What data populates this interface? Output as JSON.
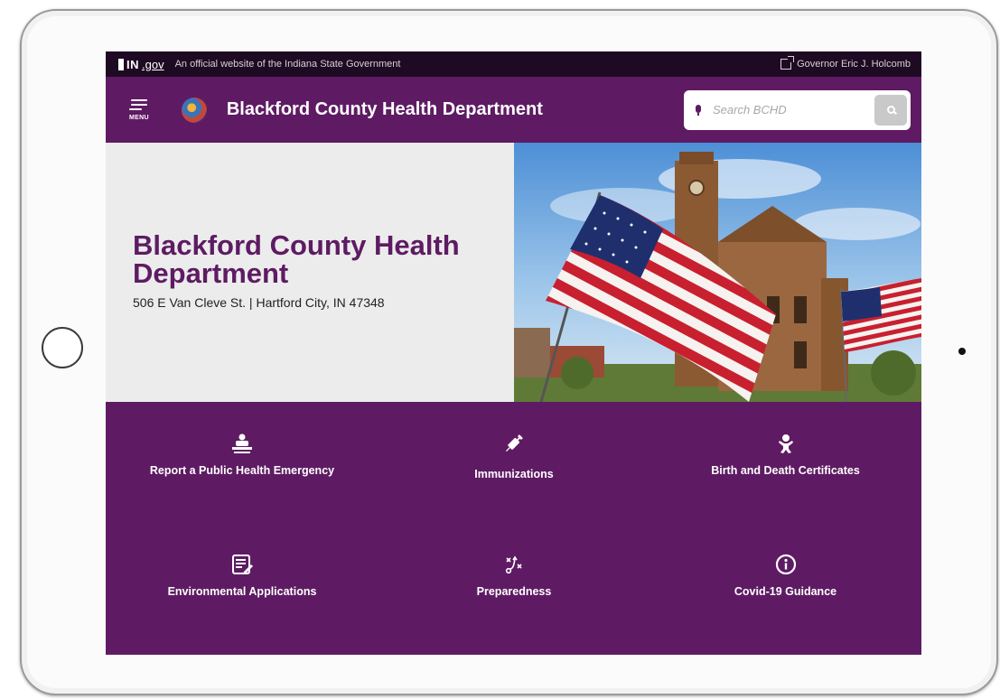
{
  "govbar": {
    "logo_in": "IN",
    "logo_gov": ".gov",
    "official_text": "An official website of the Indiana State Government",
    "governor_link": "Governor Eric J. Holcomb"
  },
  "header": {
    "menu_label": "MENU",
    "site_title": "Blackford County Health Department",
    "search_placeholder": "Search BCHD"
  },
  "hero": {
    "title": "Blackford County Health Department",
    "address": "506 E Van Cleve St. | Hartford City, IN 47348"
  },
  "tiles": [
    {
      "label": "Report a Public Health Emergency",
      "icon": "emergency-icon"
    },
    {
      "label": "Immunizations",
      "icon": "syringe-icon"
    },
    {
      "label": "Birth and Death Certificates",
      "icon": "baby-icon"
    },
    {
      "label": "Environmental Applications",
      "icon": "application-form-icon"
    },
    {
      "label": "Preparedness",
      "icon": "strategy-icon"
    },
    {
      "label": "Covid-19 Guidance",
      "icon": "info-icon"
    }
  ],
  "colors": {
    "brand_purple": "#5e1b63",
    "govbar_dark": "#1e0a22",
    "hero_left_bg": "#ececec"
  }
}
